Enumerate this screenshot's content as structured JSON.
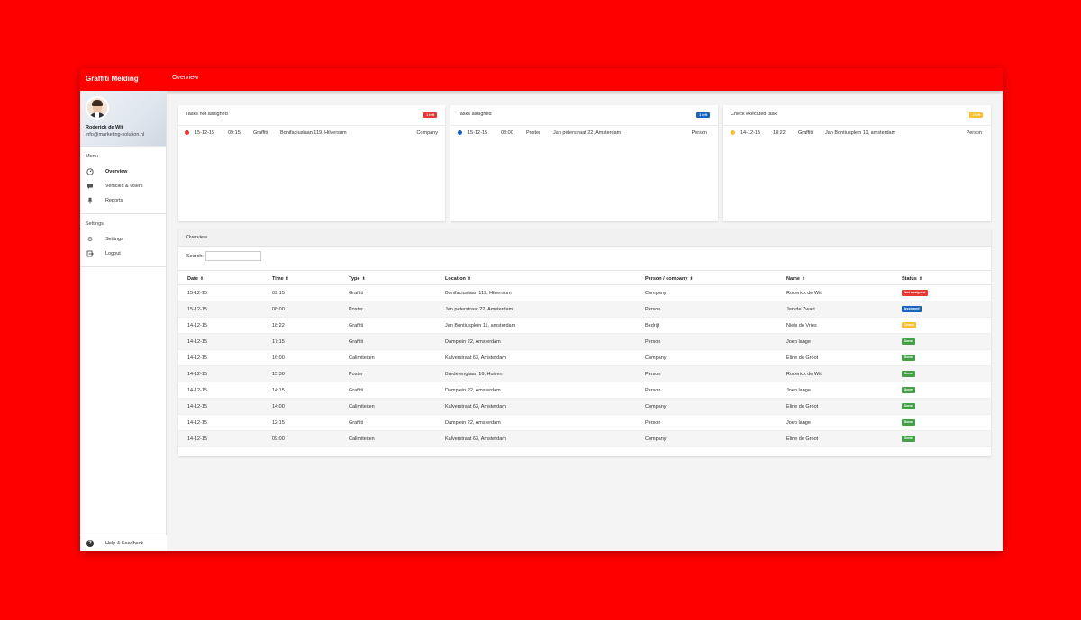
{
  "app": {
    "brand": "Graffiti Melding",
    "page_title": "Overview"
  },
  "profile": {
    "name": "Roderick de Wit",
    "email": "info@marketing-solution.nl"
  },
  "sidebar": {
    "menu_label": "Menu",
    "menu_items": [
      {
        "label": "Overview",
        "icon": "gauge-icon",
        "active": true
      },
      {
        "label": "Vehicles & Users",
        "icon": "chat-icon",
        "active": false
      },
      {
        "label": "Reports",
        "icon": "pin-icon",
        "active": false
      }
    ],
    "settings_label": "Settings",
    "settings_items": [
      {
        "label": "Settings",
        "icon": "gear-icon"
      },
      {
        "label": "Logout",
        "icon": "logout-icon"
      }
    ],
    "help_label": "Help & Feedback"
  },
  "cards": [
    {
      "title": "Tasks not assigned",
      "badge": "1 left",
      "color": "#e53935",
      "task": {
        "date": "15-12-15",
        "time": "09:15",
        "type": "Graffiti",
        "location": "Bonifaciuslaan 119, Hilversum",
        "kind": "Company"
      }
    },
    {
      "title": "Tasks assigned",
      "badge": "1 left",
      "color": "#1565c0",
      "task": {
        "date": "15-12-15",
        "time": "08:00",
        "type": "Poster",
        "location": "Jan peterstraat 22, Amsterdam",
        "kind": "Person"
      }
    },
    {
      "title": "Check executed task",
      "badge": "1 left",
      "color": "#fbc02d",
      "task": {
        "date": "14-12-15",
        "time": "18:22",
        "type": "Graffiti",
        "location": "Jan Bontiusplein 11, amsterdam",
        "kind": "Person"
      }
    }
  ],
  "overview": {
    "tab_label": "Overview",
    "search_label": "Search:",
    "search_value": "",
    "columns": [
      "Date",
      "Time",
      "Type",
      "Location",
      "Person / company",
      "Name",
      "Status"
    ],
    "sort_glyph": "⬍",
    "rows": [
      [
        "15-12-15",
        "09:15",
        "Graffiti",
        "Bonifaciuslaan 119, Hilversum",
        "Company",
        "Roderick de Wit",
        "Not assigned"
      ],
      [
        "15-12-15",
        "08:00",
        "Poster",
        "Jan peterstraat 22, Amsterdam",
        "Person",
        "Jan de Zwart",
        "Assigned"
      ],
      [
        "14-12-15",
        "18:22",
        "Graffiti",
        "Jan Bontiusplein 11, amsterdam",
        "Bedrijf",
        "Niels de Vries",
        "Check"
      ],
      [
        "14-12-15",
        "17:15",
        "Graffiti",
        "Damplein 22, Amsterdam",
        "Person",
        "Joep lange",
        "Done"
      ],
      [
        "14-12-15",
        "16:00",
        "Calimiteiten",
        "Kalverstraat 63, Amsterdam",
        "Company",
        "Eline de Groot",
        "Done"
      ],
      [
        "14-12-15",
        "15:30",
        "Poster",
        "Brede englaan 16, Huizen",
        "Person",
        "Roderick de Wit",
        "Done"
      ],
      [
        "14-12-15",
        "14:15",
        "Graffiti",
        "Damplein 22, Amsterdam",
        "Person",
        "Joep lange",
        "Done"
      ],
      [
        "14-12-15",
        "14:00",
        "Calimiteiten",
        "Kalverstraat 63, Amsterdam",
        "Company",
        "Eline de Groot",
        "Done"
      ],
      [
        "14-12-15",
        "12:15",
        "Graffiti",
        "Damplein 22, Amsterdam",
        "Person",
        "Joep lange",
        "Done"
      ],
      [
        "14-12-15",
        "09:00",
        "Calimiteiten",
        "Kalverstraat 63, Amsterdam",
        "Company",
        "Eline de Groot",
        "Done"
      ]
    ],
    "status_colors": {
      "Not assigned": "#e53935",
      "Assigned": "#1565c0",
      "Check": "#fbc02d",
      "Done": "#43a047"
    }
  },
  "colors": {
    "brand": "#ff0000"
  }
}
